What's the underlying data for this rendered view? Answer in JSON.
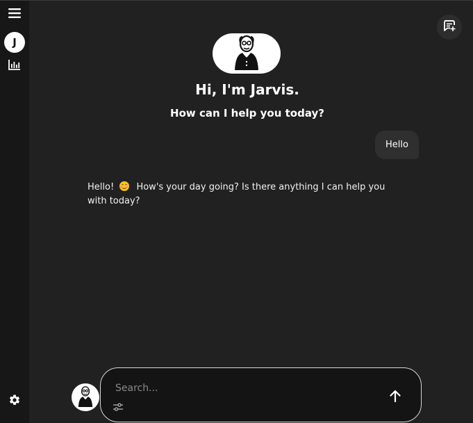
{
  "sidebar": {
    "menu_icon": "hamburger-menu-icon",
    "user_avatar_letter": "J",
    "stats_icon": "bar-chart-icon",
    "settings_icon": "gear-icon"
  },
  "top_actions": {
    "new_chat_icon": "new-chat-icon"
  },
  "header": {
    "avatar_icon": "butler-avatar-icon",
    "greeting": "Hi, I'm Jarvis.",
    "subtitle": "How can I help you today?"
  },
  "messages": [
    {
      "role": "user",
      "text": "Hello"
    },
    {
      "role": "assistant",
      "text_before_emoji": "Hello!",
      "emoji": "smiling-face-emoji",
      "text_after_emoji": "How's your day going? Is there anything I can help you with today?"
    }
  ],
  "composer": {
    "placeholder": "Search...",
    "value": "",
    "options_icon": "sliders-icon",
    "send_icon": "arrow-up-icon"
  },
  "colors": {
    "background": "#212121",
    "sidebar": "#171717",
    "user_bubble": "#2f2f2f",
    "input_background": "#141414",
    "text": "#ffffff"
  }
}
